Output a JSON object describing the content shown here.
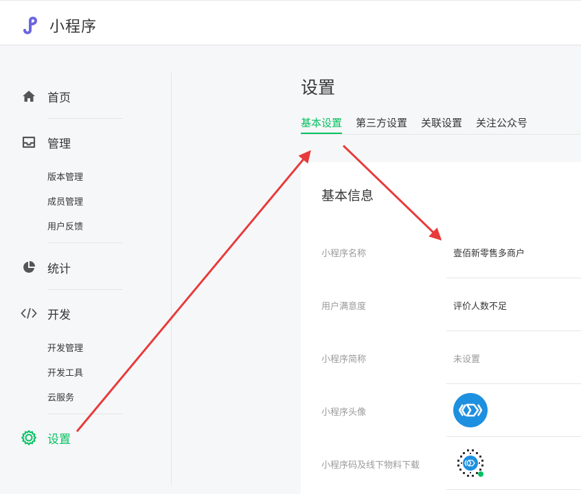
{
  "header": {
    "brand": "小程序"
  },
  "sidebar": {
    "items": [
      {
        "label": "首页",
        "icon": "home-icon"
      },
      {
        "label": "管理",
        "icon": "inbox-icon",
        "children": [
          "版本管理",
          "成员管理",
          "用户反馈"
        ]
      },
      {
        "label": "统计",
        "icon": "pie-chart-icon"
      },
      {
        "label": "开发",
        "icon": "code-icon",
        "children": [
          "开发管理",
          "开发工具",
          "云服务"
        ]
      },
      {
        "label": "设置",
        "icon": "gear-icon",
        "active": true
      }
    ]
  },
  "main": {
    "title": "设置",
    "tabs": [
      {
        "label": "基本设置",
        "active": true
      },
      {
        "label": "第三方设置"
      },
      {
        "label": "关联设置"
      },
      {
        "label": "关注公众号"
      }
    ],
    "card": {
      "title": "基本信息",
      "rows": [
        {
          "label": "小程序名称",
          "value": "壹佰新零售多商户"
        },
        {
          "label": "用户满意度",
          "value": "评价人数不足"
        },
        {
          "label": "小程序简称",
          "value": "未设置"
        },
        {
          "label": "小程序头像",
          "value": ""
        },
        {
          "label": "小程序码及线下物料下载",
          "value": ""
        }
      ]
    }
  },
  "colors": {
    "accent": "#07c160",
    "annotation_arrow": "#e83a3a",
    "avatar_bg": "#1e90e0"
  }
}
